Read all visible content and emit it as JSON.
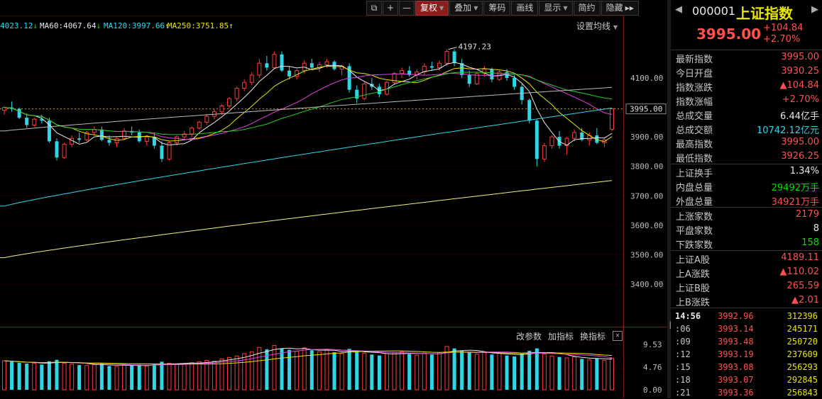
{
  "toolbar": {
    "items": [
      {
        "label": "",
        "icon": "window-restore-icon"
      },
      {
        "label": "+",
        "icon": "zoom-in-icon"
      },
      {
        "label": "—",
        "icon": "zoom-out-icon"
      },
      {
        "label": "复权",
        "dropdown": true,
        "active": true
      },
      {
        "label": "叠加",
        "dropdown": true
      },
      {
        "label": "筹码"
      },
      {
        "label": "画线"
      },
      {
        "label": "显示",
        "dropdown": true
      },
      {
        "label": "简约"
      },
      {
        "label": "隐藏",
        "arrow": "double-right-icon"
      }
    ]
  },
  "ma_legend": [
    {
      "label": "4023.12",
      "arrow": "↓",
      "color": "#2fd7e6"
    },
    {
      "label": "MA60:4067.64",
      "arrow": "↓",
      "color": "#e8e8e8"
    },
    {
      "label": "MA120:3997.66",
      "arrow": "↑",
      "color": "#2fd7e6"
    },
    {
      "label": "MA250:3751.85",
      "arrow": "↑",
      "color": "#e6e600"
    }
  ],
  "ma_settings_label": "设置均线",
  "price_axis": {
    "ticks": [
      "4100.00",
      "3900.00",
      "3800.00",
      "3700.00",
      "3600.00",
      "3500.00",
      "3400.00"
    ],
    "current": "3995.00"
  },
  "high_annotation": "4197.23",
  "volume_axis": {
    "ticks": [
      "9.53",
      "4.76",
      "0.00"
    ]
  },
  "volume_buttons": [
    "改参数",
    "加指标",
    "换指标"
  ],
  "chart_data": {
    "type": "candlestick",
    "price_range": [
      3350,
      4270
    ],
    "current_price": 3995.0,
    "high_marked": 4197.23,
    "candles": [
      [
        3990,
        4005,
        3975,
        4000
      ],
      [
        4000,
        4020,
        3985,
        3995
      ],
      [
        3995,
        4000,
        3960,
        3965
      ],
      [
        3965,
        3980,
        3930,
        3940
      ],
      [
        3940,
        3965,
        3935,
        3960
      ],
      [
        3960,
        3975,
        3945,
        3955
      ],
      [
        3955,
        3965,
        3880,
        3885
      ],
      [
        3885,
        3895,
        3820,
        3830
      ],
      [
        3830,
        3880,
        3825,
        3875
      ],
      [
        3875,
        3905,
        3865,
        3895
      ],
      [
        3895,
        3915,
        3880,
        3890
      ],
      [
        3890,
        3920,
        3885,
        3915
      ],
      [
        3915,
        3935,
        3905,
        3925
      ],
      [
        3925,
        3935,
        3885,
        3890
      ],
      [
        3890,
        3905,
        3870,
        3880
      ],
      [
        3880,
        3900,
        3865,
        3895
      ],
      [
        3895,
        3930,
        3890,
        3920
      ],
      [
        3920,
        3935,
        3905,
        3915
      ],
      [
        3915,
        3925,
        3880,
        3885
      ],
      [
        3885,
        3905,
        3870,
        3900
      ],
      [
        3900,
        3915,
        3860,
        3870
      ],
      [
        3870,
        3885,
        3815,
        3825
      ],
      [
        3825,
        3885,
        3820,
        3880
      ],
      [
        3880,
        3905,
        3870,
        3900
      ],
      [
        3900,
        3920,
        3890,
        3910
      ],
      [
        3910,
        3935,
        3900,
        3930
      ],
      [
        3930,
        3955,
        3925,
        3950
      ],
      [
        3950,
        3975,
        3940,
        3970
      ],
      [
        3970,
        3995,
        3960,
        3985
      ],
      [
        3985,
        4010,
        3975,
        4005
      ],
      [
        4005,
        4035,
        3995,
        4030
      ],
      [
        4030,
        4070,
        4020,
        4065
      ],
      [
        4065,
        4095,
        4055,
        4085
      ],
      [
        4085,
        4120,
        4075,
        4110
      ],
      [
        4110,
        4165,
        4100,
        4150
      ],
      [
        4150,
        4175,
        4125,
        4135
      ],
      [
        4135,
        4190,
        4130,
        4180
      ],
      [
        4180,
        4190,
        4120,
        4125
      ],
      [
        4125,
        4140,
        4095,
        4105
      ],
      [
        4105,
        4130,
        4095,
        4125
      ],
      [
        4125,
        4160,
        4115,
        4150
      ],
      [
        4150,
        4165,
        4130,
        4135
      ],
      [
        4135,
        4155,
        4120,
        4145
      ],
      [
        4145,
        4165,
        4135,
        4155
      ],
      [
        4155,
        4160,
        4125,
        4130
      ],
      [
        4130,
        4145,
        4110,
        4140
      ],
      [
        4140,
        4150,
        4050,
        4060
      ],
      [
        4060,
        4075,
        4015,
        4030
      ],
      [
        4030,
        4085,
        4025,
        4080
      ],
      [
        4080,
        4100,
        4060,
        4070
      ],
      [
        4070,
        4080,
        4035,
        4045
      ],
      [
        4045,
        4090,
        4040,
        4085
      ],
      [
        4085,
        4120,
        4080,
        4115
      ],
      [
        4115,
        4135,
        4100,
        4125
      ],
      [
        4125,
        4140,
        4105,
        4110
      ],
      [
        4110,
        4130,
        4095,
        4120
      ],
      [
        4120,
        4150,
        4110,
        4140
      ],
      [
        4140,
        4155,
        4125,
        4135
      ],
      [
        4135,
        4160,
        4125,
        4150
      ],
      [
        4150,
        4197,
        4140,
        4190
      ],
      [
        4190,
        4197,
        4140,
        4150
      ],
      [
        4150,
        4165,
        4100,
        4110
      ],
      [
        4110,
        4125,
        4070,
        4080
      ],
      [
        4080,
        4120,
        4075,
        4115
      ],
      [
        4115,
        4140,
        4105,
        4130
      ],
      [
        4130,
        4135,
        4085,
        4095
      ],
      [
        4095,
        4125,
        4090,
        4120
      ],
      [
        4120,
        4130,
        4090,
        4100
      ],
      [
        4100,
        4110,
        4060,
        4070
      ],
      [
        4070,
        4080,
        4010,
        4025
      ],
      [
        4025,
        4030,
        3945,
        3955
      ],
      [
        3955,
        3960,
        3800,
        3825
      ],
      [
        3825,
        3880,
        3815,
        3870
      ],
      [
        3870,
        3905,
        3860,
        3900
      ],
      [
        3900,
        3920,
        3860,
        3870
      ],
      [
        3870,
        3900,
        3840,
        3895
      ],
      [
        3895,
        3925,
        3885,
        3915
      ],
      [
        3915,
        3930,
        3885,
        3890
      ],
      [
        3890,
        3915,
        3870,
        3905
      ],
      [
        3905,
        3930,
        3875,
        3880
      ],
      [
        3880,
        3895,
        3865,
        3890
      ],
      [
        3926,
        3998,
        3920,
        3995
      ]
    ],
    "volumes": [
      6.1,
      5.9,
      5.7,
      5.5,
      5.6,
      5.3,
      6.0,
      6.3,
      5.6,
      5.4,
      5.2,
      5.1,
      5.3,
      5.5,
      5.0,
      4.9,
      5.2,
      5.1,
      5.3,
      5.0,
      5.4,
      5.9,
      5.6,
      5.4,
      5.5,
      5.7,
      5.9,
      6.2,
      6.0,
      6.5,
      6.8,
      7.1,
      7.6,
      8.0,
      8.9,
      8.5,
      9.3,
      8.7,
      8.4,
      8.1,
      8.8,
      8.3,
      8.0,
      8.5,
      7.9,
      7.6,
      8.6,
      8.1,
      7.7,
      7.4,
      7.2,
      7.6,
      7.8,
      8.0,
      7.5,
      7.3,
      7.7,
      7.4,
      7.8,
      9.1,
      8.7,
      8.2,
      7.8,
      7.5,
      7.9,
      7.4,
      7.7,
      7.2,
      7.0,
      7.6,
      8.2,
      8.7,
      7.5,
      7.1,
      6.9,
      6.7,
      6.9,
      6.5,
      6.3,
      6.6,
      6.2,
      6.6
    ]
  },
  "panel": {
    "code": "000001",
    "name": "上证指数",
    "price": "3995.00",
    "change": "+104.84",
    "change_pct": "+2.70%",
    "stats": [
      {
        "k": "最新指数",
        "v": "3995.00",
        "c": "red"
      },
      {
        "k": "今日开盘",
        "v": "3930.25",
        "c": "red"
      },
      {
        "k": "指数涨跌",
        "v": "▲104.84",
        "c": "red"
      },
      {
        "k": "指数涨幅",
        "v": "+2.70%",
        "c": "red"
      },
      {
        "k": "总成交量",
        "v": "6.44亿手",
        "c": "white"
      },
      {
        "k": "总成交额",
        "v": "10742.12亿元",
        "c": "cyan"
      },
      {
        "k": "最高指数",
        "v": "3995.00",
        "c": "red"
      },
      {
        "k": "最低指数",
        "v": "3926.25",
        "c": "red"
      }
    ],
    "stats2": [
      {
        "k": "上证换手",
        "v": "1.34%",
        "c": "white"
      },
      {
        "k": "内盘总量",
        "v": "29492万手",
        "c": "green"
      },
      {
        "k": "外盘总量",
        "v": "34921万手",
        "c": "red"
      }
    ],
    "stats3": [
      {
        "k": "上涨家数",
        "v": "2179",
        "c": "red"
      },
      {
        "k": "平盘家数",
        "v": "8",
        "c": "white"
      },
      {
        "k": "下跌家数",
        "v": "158",
        "c": "green"
      }
    ],
    "stats4": [
      {
        "k": "上证A股",
        "v": "4189.11",
        "c": "red"
      },
      {
        "k": "上A涨跌",
        "v": "▲110.02",
        "c": "red"
      },
      {
        "k": "上证B股",
        "v": "265.59",
        "c": "red"
      },
      {
        "k": "上B涨跌",
        "v": "▲2.01",
        "c": "red"
      }
    ],
    "ticks": [
      {
        "t": "14:56",
        "p": "3992.96",
        "q": "312396"
      },
      {
        "t": ":06",
        "p": "3993.14",
        "q": "245171"
      },
      {
        "t": ":09",
        "p": "3993.48",
        "q": "250720"
      },
      {
        "t": ":12",
        "p": "3993.19",
        "q": "237609"
      },
      {
        "t": ":15",
        "p": "3993.08",
        "q": "256293"
      },
      {
        "t": ":18",
        "p": "3993.07",
        "q": "292845"
      },
      {
        "t": ":21",
        "p": "3993.36",
        "q": "256843"
      }
    ]
  }
}
